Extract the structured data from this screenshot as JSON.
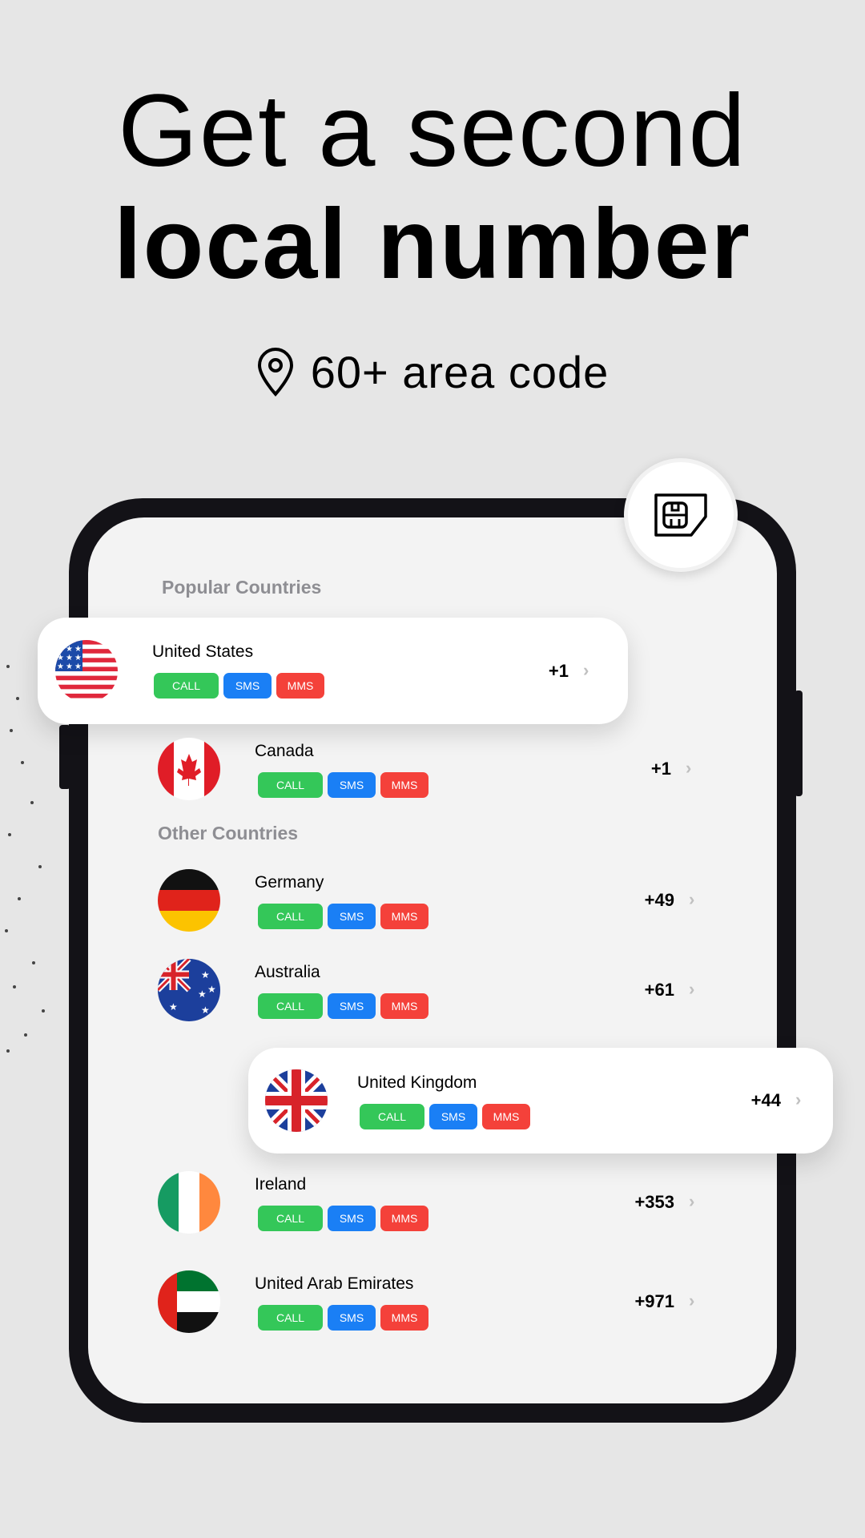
{
  "headline": {
    "line1": "Get a second",
    "line2": "local number",
    "subtitle": "60+ area code",
    "subtitle_icon": "location-pin-icon"
  },
  "sim_icon": "sim-card-icon",
  "sections": {
    "popular": "Popular Countries",
    "other": "Other Countries"
  },
  "badges": {
    "call": "CALL",
    "sms": "SMS",
    "mms": "MMS"
  },
  "colors": {
    "call": "#34c759",
    "sms": "#1a7ff5",
    "mms": "#f4413a",
    "background": "#e6e6e6",
    "frame": "#131217"
  },
  "countries": [
    {
      "name": "United States",
      "code": "+1",
      "flag": "us-flag-icon"
    },
    {
      "name": "Canada",
      "code": "+1",
      "flag": "canada-flag-icon"
    },
    {
      "name": "Germany",
      "code": "+49",
      "flag": "germany-flag-icon"
    },
    {
      "name": "Australia",
      "code": "+61",
      "flag": "australia-flag-icon"
    },
    {
      "name": "United Kingdom",
      "code": "+44",
      "flag": "uk-flag-icon"
    },
    {
      "name": "Ireland",
      "code": "+353",
      "flag": "ireland-flag-icon"
    },
    {
      "name": "United Arab Emirates",
      "code": "+971",
      "flag": "uae-flag-icon"
    }
  ]
}
